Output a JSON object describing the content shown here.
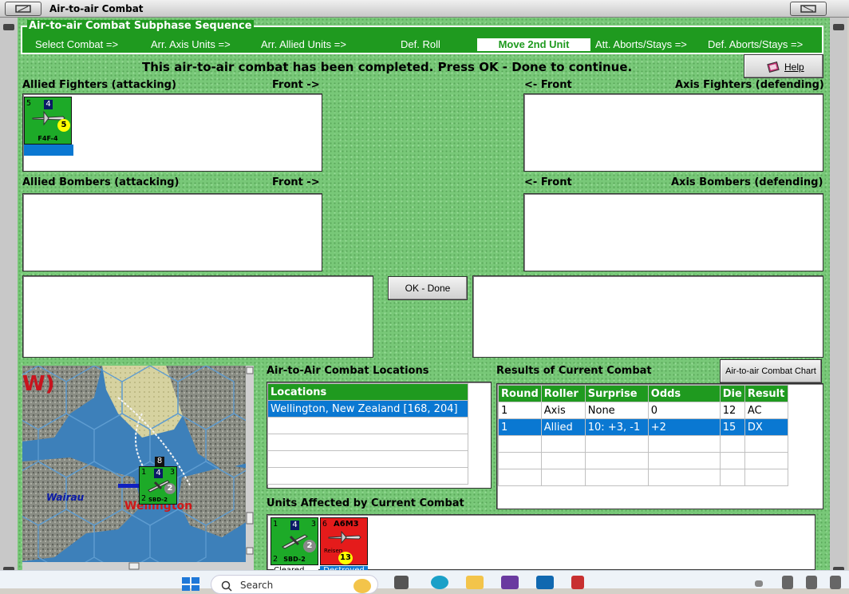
{
  "window": {
    "title": "Air-to-air Combat"
  },
  "sequence": {
    "title": "Air-to-air Combat Subphase Sequence",
    "steps": [
      "Select Combat =>",
      "Arr. Axis Units =>",
      "Arr. Allied Units =>",
      "Def. Roll",
      "Move 2nd Unit",
      "Att. Aborts/Stays =>",
      "Def. Aborts/Stays =>"
    ],
    "active_index": 4
  },
  "notice": "This air-to-air combat has been completed.  Press OK - Done to continue.",
  "help_label": "Help",
  "panels": {
    "allied_fighters": "Allied Fighters (attacking)",
    "allied_fighters_front": "Front ->",
    "axis_fighters_front": "<- Front",
    "axis_fighters": "Axis Fighters (defending)",
    "allied_bombers": "Allied Bombers (attacking)",
    "allied_bombers_front": "Front ->",
    "axis_bombers_front": "<- Front",
    "axis_bombers": "Axis Bombers (defending)"
  },
  "fighter_unit": {
    "left": "5",
    "box": "4",
    "right": "5",
    "type": "F4F-4"
  },
  "ok_label": "OK - Done",
  "chart_button": "Air-to-air Combat Chart",
  "locations": {
    "title": "Air-to-Air Combat Locations",
    "header": "Locations",
    "rows": [
      "Wellington, New Zealand [168, 204]"
    ]
  },
  "results": {
    "title": "Results of Current Combat",
    "headers": [
      "Round",
      "Roller",
      "Surprise",
      "Odds",
      "Die",
      "Result"
    ],
    "rows": [
      [
        "1",
        "Axis",
        "None",
        "0",
        "12",
        "AC"
      ],
      [
        "1",
        "Allied",
        "10: +3, -1",
        "+2",
        "15",
        "DX"
      ]
    ],
    "selected_row": 1
  },
  "units_affected": {
    "title": "Units Affected by Current Combat",
    "unit1": {
      "left": "1",
      "box": "4",
      "right": "3",
      "bottom_left": "2",
      "circle": "2",
      "type": "SBD-2",
      "status": "Cleared"
    },
    "unit2": {
      "left": "6",
      "type": "A6M3",
      "sub": "Reisen",
      "circle": "13",
      "status": "Destroyed"
    }
  },
  "map": {
    "corner_text": "W)",
    "place1": "Wairau",
    "place2": "Wellington",
    "stack_count": "8",
    "unit": {
      "left": "1",
      "box": "4",
      "right": "3",
      "bottom_left": "2",
      "circle": "2",
      "type": "SBD-2"
    }
  },
  "taskbar": {
    "search": "Search"
  },
  "colors": {
    "green_header": "#1f9a1f",
    "selection": "#0a78d2",
    "destroyed": "#e51b1b",
    "allied_counter": "#1daa28"
  }
}
